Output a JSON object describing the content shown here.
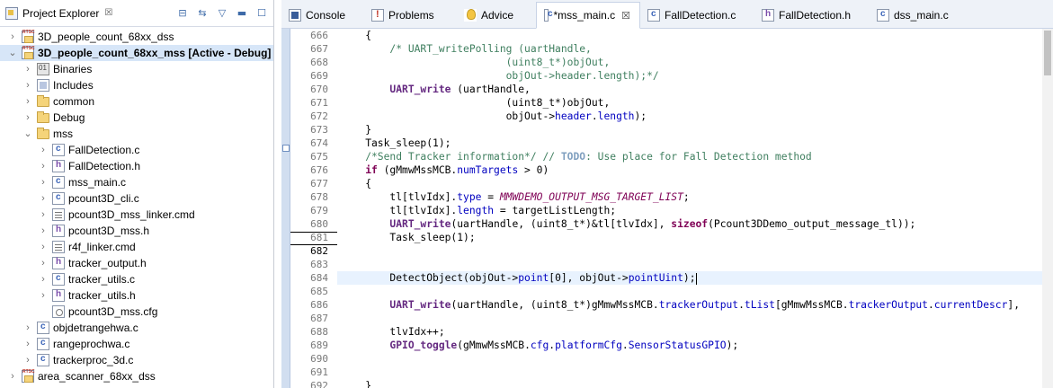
{
  "explorer": {
    "title": "Project Explorer",
    "close_glyph": "☒",
    "tree": [
      {
        "label": "3D_people_count_68xx_dss",
        "icon": "project-icon",
        "indent": 0,
        "chevron": "›",
        "bold": false,
        "selected": false
      },
      {
        "label": "3D_people_count_68xx_mss  [Active - Debug]",
        "icon": "project-icon",
        "indent": 0,
        "chevron": "⌄",
        "bold": true,
        "selected": true
      },
      {
        "label": "Binaries",
        "icon": "binaries-icon",
        "indent": 1,
        "chevron": "›",
        "bold": false,
        "selected": false
      },
      {
        "label": "Includes",
        "icon": "includes-icon",
        "indent": 1,
        "chevron": "›",
        "bold": false,
        "selected": false
      },
      {
        "label": "common",
        "icon": "folder-icon",
        "indent": 1,
        "chevron": "›",
        "bold": false,
        "selected": false
      },
      {
        "label": "Debug",
        "icon": "folder-icon",
        "indent": 1,
        "chevron": "›",
        "bold": false,
        "selected": false
      },
      {
        "label": "mss",
        "icon": "folder-icon",
        "indent": 1,
        "chevron": "⌄",
        "bold": false,
        "selected": false
      },
      {
        "label": "FallDetection.c",
        "icon": "c-file-icon",
        "indent": 2,
        "chevron": "›",
        "bold": false,
        "selected": false
      },
      {
        "label": "FallDetection.h",
        "icon": "h-file-icon",
        "indent": 2,
        "chevron": "›",
        "bold": false,
        "selected": false
      },
      {
        "label": "mss_main.c",
        "icon": "c-file-icon",
        "indent": 2,
        "chevron": "›",
        "bold": false,
        "selected": false
      },
      {
        "label": "pcount3D_cli.c",
        "icon": "c-file-icon",
        "indent": 2,
        "chevron": "›",
        "bold": false,
        "selected": false
      },
      {
        "label": "pcount3D_mss_linker.cmd",
        "icon": "cmd-file-icon",
        "indent": 2,
        "chevron": "›",
        "bold": false,
        "selected": false
      },
      {
        "label": "pcount3D_mss.h",
        "icon": "h-file-icon",
        "indent": 2,
        "chevron": "›",
        "bold": false,
        "selected": false
      },
      {
        "label": "r4f_linker.cmd",
        "icon": "cmd-file-icon",
        "indent": 2,
        "chevron": "›",
        "bold": false,
        "selected": false
      },
      {
        "label": "tracker_output.h",
        "icon": "h-file-icon",
        "indent": 2,
        "chevron": "›",
        "bold": false,
        "selected": false
      },
      {
        "label": "tracker_utils.c",
        "icon": "c-file-icon",
        "indent": 2,
        "chevron": "›",
        "bold": false,
        "selected": false
      },
      {
        "label": "tracker_utils.h",
        "icon": "h-file-icon",
        "indent": 2,
        "chevron": "›",
        "bold": false,
        "selected": false
      },
      {
        "label": "pcount3D_mss.cfg",
        "icon": "cfg-file-icon",
        "indent": 2,
        "chevron": "",
        "bold": false,
        "selected": false
      },
      {
        "label": "objdetrangehwa.c",
        "icon": "c-file-icon",
        "indent": 1,
        "chevron": "›",
        "bold": false,
        "selected": false
      },
      {
        "label": "rangeprochwa.c",
        "icon": "c-file-icon",
        "indent": 1,
        "chevron": "›",
        "bold": false,
        "selected": false
      },
      {
        "label": "trackerproc_3d.c",
        "icon": "c-file-icon",
        "indent": 1,
        "chevron": "›",
        "bold": false,
        "selected": false
      },
      {
        "label": "area_scanner_68xx_dss",
        "icon": "project-icon",
        "indent": 0,
        "chevron": "›",
        "bold": false,
        "selected": false
      }
    ]
  },
  "tabs": [
    {
      "label": "Console",
      "icon": "console",
      "icon_name": "console-icon",
      "active": false,
      "closable": false,
      "width": 92
    },
    {
      "label": "Problems",
      "icon": "problems",
      "icon_name": "problems-icon",
      "active": false,
      "closable": false,
      "width": 103
    },
    {
      "label": "Advice",
      "icon": "advice",
      "icon_name": "advice-icon",
      "active": false,
      "closable": false,
      "width": 88
    },
    {
      "label": "*mss_main.c",
      "icon": "c",
      "icon_name": "c-file-icon",
      "active": true,
      "closable": true,
      "width": 116
    },
    {
      "label": "FallDetection.c",
      "icon": "c",
      "icon_name": "c-file-icon",
      "active": false,
      "closable": false,
      "width": 127
    },
    {
      "label": "FallDetection.h",
      "icon": "h",
      "icon_name": "h-file-icon",
      "active": false,
      "closable": false,
      "width": 128
    },
    {
      "label": "dss_main.c",
      "icon": "c",
      "icon_name": "c-file-icon",
      "active": false,
      "closable": false,
      "width": 100
    }
  ],
  "close_glyph": "☒",
  "editor": {
    "current_line": 682,
    "lines": [
      {
        "n": 666,
        "tokens": [
          [
            "t",
            "    {"
          ]
        ]
      },
      {
        "n": 667,
        "tokens": [
          [
            "cm",
            "        /* UART_writePolling (uartHandle,"
          ]
        ]
      },
      {
        "n": 668,
        "tokens": [
          [
            "cm",
            "                           (uint8_t*)objOut,"
          ]
        ]
      },
      {
        "n": 669,
        "tokens": [
          [
            "cm",
            "                           objOut->header.length);*/"
          ]
        ]
      },
      {
        "n": 670,
        "tokens": [
          [
            "t",
            "        "
          ],
          [
            "fn",
            "UART_write"
          ],
          [
            "t",
            " (uartHandle,"
          ]
        ]
      },
      {
        "n": 671,
        "tokens": [
          [
            "t",
            "                           (uint8_t*)objOut,"
          ]
        ]
      },
      {
        "n": 672,
        "tokens": [
          [
            "t",
            "                           objOut->"
          ],
          [
            "fld",
            "header"
          ],
          [
            "t",
            "."
          ],
          [
            "fld",
            "length"
          ],
          [
            "t",
            ");"
          ]
        ]
      },
      {
        "n": 673,
        "tokens": [
          [
            "t",
            "    }"
          ]
        ]
      },
      {
        "n": 674,
        "tokens": [
          [
            "t",
            "    Task_sleep(1);"
          ]
        ]
      },
      {
        "n": 675,
        "tokens": [
          [
            "cm",
            "    /*Send Tracker information*/ // "
          ],
          [
            "todo",
            "TODO"
          ],
          [
            "cm",
            ": Use place for Fall Detection method"
          ]
        ]
      },
      {
        "n": 676,
        "tokens": [
          [
            "kw",
            "    if"
          ],
          [
            "t",
            " (gMmwMssMCB."
          ],
          [
            "fld",
            "numTargets"
          ],
          [
            "t",
            " > 0)"
          ]
        ]
      },
      {
        "n": 677,
        "tokens": [
          [
            "t",
            "    {"
          ]
        ]
      },
      {
        "n": 678,
        "tokens": [
          [
            "t",
            "        tl[tlvIdx]."
          ],
          [
            "fld",
            "type"
          ],
          [
            "t",
            " = "
          ],
          [
            "mac",
            "MMWDEMO_OUTPUT_MSG_TARGET_LIST"
          ],
          [
            "t",
            ";"
          ]
        ]
      },
      {
        "n": 679,
        "tokens": [
          [
            "t",
            "        tl[tlvIdx]."
          ],
          [
            "fld",
            "length"
          ],
          [
            "t",
            " = targetListLength;"
          ]
        ]
      },
      {
        "n": 680,
        "tokens": [
          [
            "t",
            "        "
          ],
          [
            "fn",
            "UART_write"
          ],
          [
            "t",
            "(uartHandle, (uint8_t*)&tl[tlvIdx], "
          ],
          [
            "kw",
            "sizeof"
          ],
          [
            "t",
            "(Pcount3DDemo_output_message_tl));"
          ]
        ]
      },
      {
        "n": 681,
        "tokens": [
          [
            "t",
            "        Task_sleep(1);"
          ]
        ]
      },
      {
        "n": 682,
        "tokens": [
          [
            "t",
            ""
          ]
        ]
      },
      {
        "n": 683,
        "tokens": [
          [
            "t",
            ""
          ]
        ]
      },
      {
        "n": 684,
        "tokens": [
          [
            "t",
            "        DetectObject(objOut->"
          ],
          [
            "fld",
            "point"
          ],
          [
            "t",
            "[0], objOut->"
          ],
          [
            "fld",
            "pointUint"
          ],
          [
            "t",
            ");"
          ]
        ],
        "cursor": true
      },
      {
        "n": 685,
        "tokens": [
          [
            "t",
            ""
          ]
        ]
      },
      {
        "n": 686,
        "tokens": [
          [
            "t",
            "        "
          ],
          [
            "fn",
            "UART_write"
          ],
          [
            "t",
            "(uartHandle, (uint8_t*)gMmwMssMCB."
          ],
          [
            "fld",
            "trackerOutput"
          ],
          [
            "t",
            "."
          ],
          [
            "fld",
            "tList"
          ],
          [
            "t",
            "[gMmwMssMCB."
          ],
          [
            "fld",
            "trackerOutput"
          ],
          [
            "t",
            "."
          ],
          [
            "fld",
            "currentDescr"
          ],
          [
            "t",
            "],"
          ]
        ]
      },
      {
        "n": 687,
        "tokens": [
          [
            "t",
            ""
          ]
        ]
      },
      {
        "n": 688,
        "tokens": [
          [
            "t",
            "        tlvIdx++;"
          ]
        ]
      },
      {
        "n": 689,
        "tokens": [
          [
            "t",
            "        "
          ],
          [
            "fn",
            "GPIO_toggle"
          ],
          [
            "t",
            "(gMmwMssMCB."
          ],
          [
            "fld",
            "cfg"
          ],
          [
            "t",
            "."
          ],
          [
            "fld",
            "platformCfg"
          ],
          [
            "t",
            "."
          ],
          [
            "fld",
            "SensorStatusGPIO"
          ],
          [
            "t",
            ");"
          ]
        ]
      },
      {
        "n": 690,
        "tokens": [
          [
            "t",
            ""
          ]
        ]
      },
      {
        "n": 691,
        "tokens": [
          [
            "t",
            ""
          ]
        ]
      },
      {
        "n": 692,
        "tokens": [
          [
            "t",
            "    }"
          ]
        ]
      }
    ]
  }
}
